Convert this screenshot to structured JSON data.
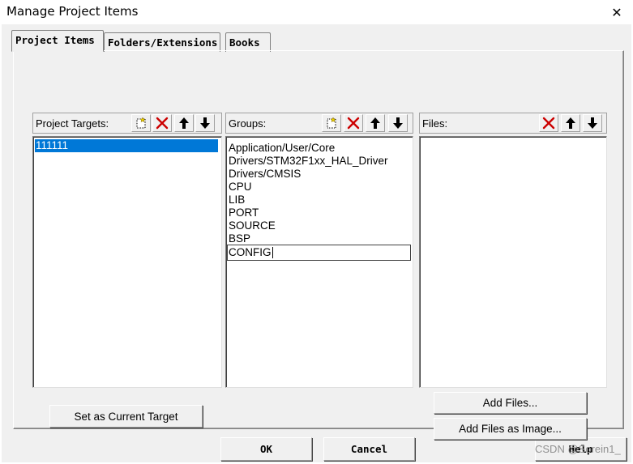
{
  "window": {
    "title": "Manage Project Items",
    "close_label": "✕"
  },
  "tabs": [
    {
      "label": "Project Items"
    },
    {
      "label": "Folders/Extensions"
    },
    {
      "label": "Books"
    }
  ],
  "targets": {
    "header": "Project Targets:",
    "items": [
      "111111"
    ],
    "set_current_label": "Set as Current Target"
  },
  "groups": {
    "header": "Groups:",
    "items": [
      "Application/User/Core",
      "Drivers/STM32F1xx_HAL_Driver",
      "Drivers/CMSIS",
      "CPU",
      "LIB",
      "PORT",
      "SOURCE",
      "BSP"
    ],
    "editing_value": "CONFIG"
  },
  "files": {
    "header": "Files:",
    "add_files_label": "Add Files...",
    "add_files_image_label": "Add Files as Image..."
  },
  "footer": {
    "ok_label": "OK",
    "cancel_label": "Cancel",
    "help_label": "Help"
  },
  "watermark": "CSDN @Sorein1_",
  "icons": {
    "new": "new-icon",
    "delete": "delete-icon",
    "up": "move-up-icon",
    "down": "move-down-icon"
  },
  "colors": {
    "selection": "#0078d7",
    "delete": "#cc0000",
    "background": "#f0f0f0"
  }
}
